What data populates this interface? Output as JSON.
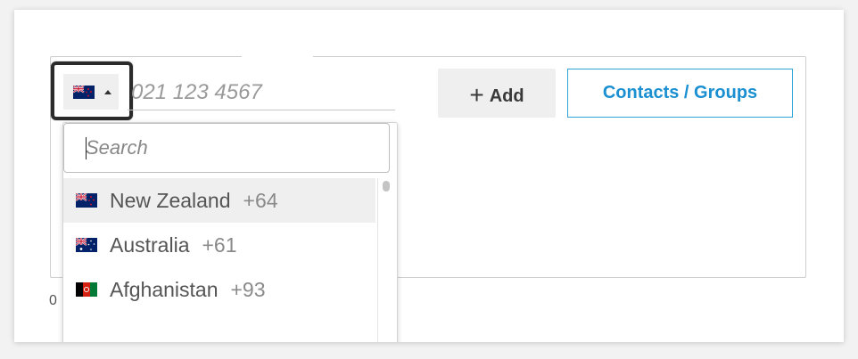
{
  "phone": {
    "placeholder": "021 123 4567",
    "selected_country_flag": "nz-flag-icon"
  },
  "actions": {
    "add_label": "Add",
    "add_icon": "plus-icon",
    "contacts_label": "Contacts / Groups"
  },
  "dropdown": {
    "search_placeholder": "Search",
    "items": [
      {
        "name": "New Zealand",
        "code": "+64",
        "flag": "nz-flag-icon",
        "active": true
      },
      {
        "name": "Australia",
        "code": "+61",
        "flag": "au-flag-icon",
        "active": false
      },
      {
        "name": "Afghanistan",
        "code": "+93",
        "flag": "af-flag-icon",
        "active": false
      }
    ]
  },
  "stray_text": "0",
  "colors": {
    "accent": "#1a8fd1",
    "accent_border": "#2ea3d6",
    "active_row": "#efefef"
  }
}
